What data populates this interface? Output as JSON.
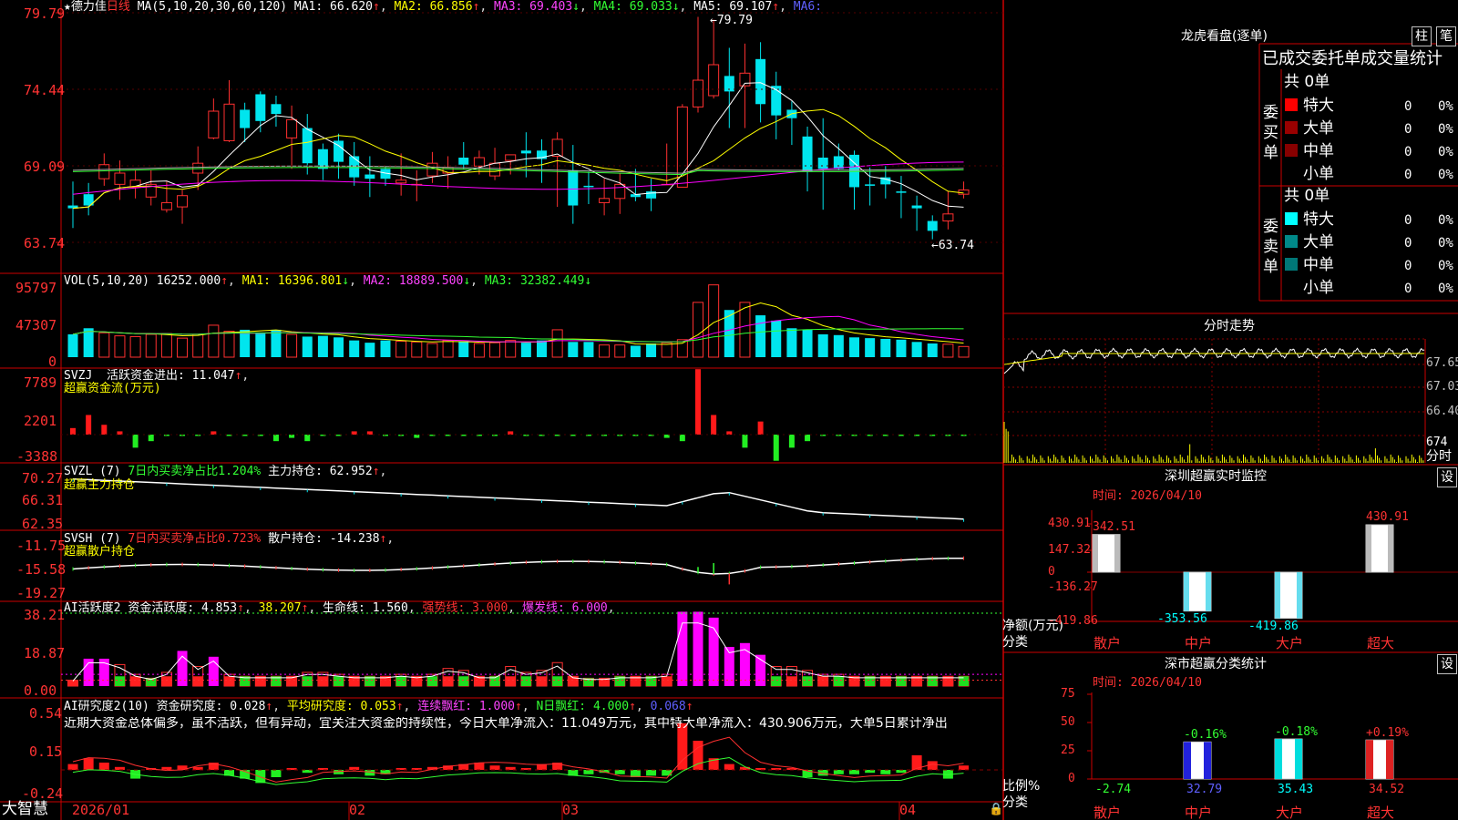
{
  "stock": {
    "name": "德力佳",
    "period": "日线"
  },
  "brand": "大智慧",
  "kline": {
    "ma_text": "MA(5,10,20,30,60,120)",
    "ma1": "MA1: 66.620",
    "ma2": "MA2: 66.856",
    "ma3": "MA3: 69.403",
    "ma4": "MA4: 69.033",
    "ma5": "MA5: 69.107",
    "ma6": "MA6:",
    "y_labels": [
      "79.79",
      "74.44",
      "69.09",
      "63.74"
    ],
    "high_label": "79.79",
    "low_label": "63.74"
  },
  "volume": {
    "title": "VOL(5,10,20)",
    "value": "16252.000",
    "ma1": "MA1: 16396.801",
    "ma2": "MA2: 18889.500",
    "ma3": "MA3: 32382.449",
    "y_labels": [
      "95797",
      "47307",
      "0"
    ]
  },
  "svzj": {
    "title": "SVZJ",
    "item": "活跃资金进出: 11.047",
    "subtitle": "超赢资金流(万元)",
    "y_labels": [
      "7789",
      "2201",
      "-3388"
    ]
  },
  "svzl": {
    "title": "SVZL (7)",
    "item1": "7日内买卖净占比1.204%",
    "item2": "主力持仓: 62.952",
    "subtitle": "超赢主力持仓",
    "y_labels": [
      "70.27",
      "66.31",
      "62.35"
    ]
  },
  "svsh": {
    "title": "SVSH (7)",
    "item1": "7日内买卖净占比0.723%",
    "item2": "散户持仓: -14.238",
    "subtitle": "超赢散户持仓",
    "y_labels": [
      "-11.75",
      "-15.58",
      "-19.27"
    ]
  },
  "ai_active": {
    "title": "AI活跃度2",
    "item1": "资金活跃度: 4.853",
    "item2": "38.207",
    "item3": "生命线: 1.560",
    "item4": "强势线: 3.000",
    "item5": "爆发线: 6.000",
    "y_labels": [
      "38.21",
      "18.87",
      "0.00"
    ]
  },
  "ai_research": {
    "title": "AI研究度2(10)",
    "item1": "资金研究度: 0.028",
    "item2": "平均研究度: 0.053",
    "item3": "连续飘红: 1.000",
    "item4": "N日飘红: 4.000",
    "item5": "0.068",
    "commentary": "近期大资金总体偏多，虽不活跃，但有异动，宜关注大资金的持续性，今日大单净流入：11.049万元，其中特大单净流入：430.906万元，大单5日累计净出",
    "y_labels": [
      "0.54",
      "0.15",
      "-0.24"
    ]
  },
  "x_axis": [
    "2026/01",
    "02",
    "03",
    "04"
  ],
  "longhu": {
    "title": "龙虎看盘(逐单)",
    "btn1": "柱",
    "btn2": "笔",
    "subtitle": "已成交委托单成交量统计",
    "buy_label": "委买单",
    "sell_label": "委卖单",
    "buy_total": "共 0单",
    "sell_total": "共 0单",
    "buy_rows": [
      {
        "name": "特大",
        "count": "0",
        "pct": "0%"
      },
      {
        "name": "大单",
        "count": "0",
        "pct": "0%"
      },
      {
        "name": "中单",
        "count": "0",
        "pct": "0%"
      },
      {
        "name": "小单",
        "count": "0",
        "pct": "0%"
      }
    ],
    "sell_rows": [
      {
        "name": "特大",
        "count": "0",
        "pct": "0%"
      },
      {
        "name": "大单",
        "count": "0",
        "pct": "0%"
      },
      {
        "name": "中单",
        "count": "0",
        "pct": "0%"
      },
      {
        "name": "小单",
        "count": "0",
        "pct": "0%"
      }
    ]
  },
  "intraday": {
    "title": "分时走势",
    "y_labels": [
      "67.65",
      "67.03",
      "66.40"
    ],
    "vol_label": "674",
    "time_label": "分时"
  },
  "realtime": {
    "title": "深圳超赢实时监控",
    "btn": "设",
    "time": "时间: 2026/04/10",
    "ylabel": "净额(万元)",
    "xlabel": "分类"
  },
  "classify": {
    "title": "深市超赢分类统计",
    "btn": "设",
    "time": "时间: 2026/04/10",
    "ylabel": "比例%",
    "xlabel": "分类"
  },
  "chart_data": [
    {
      "type": "bar",
      "title": "深圳超赢实时监控",
      "xlabel": "分类",
      "ylabel": "净额(万元)",
      "categories": [
        "散户",
        "中户",
        "大户",
        "超大"
      ],
      "values": [
        342.51,
        -353.56,
        -419.86,
        430.91
      ],
      "y_ticks": [
        "430.91",
        "147.32",
        "0",
        "-136.27",
        "-419.86"
      ],
      "ylim": [
        -419.86,
        430.91
      ]
    },
    {
      "type": "bar",
      "title": "深市超赢分类统计",
      "xlabel": "分类",
      "ylabel": "比例%",
      "categories": [
        "散户",
        "中户",
        "大户",
        "超大"
      ],
      "values": [
        -2.74,
        32.79,
        35.43,
        34.52
      ],
      "changes": [
        "",
        "-0.16%",
        "-0.18%",
        "+0.19%"
      ],
      "y_ticks": [
        "75",
        "50",
        "25",
        "0"
      ],
      "ylim": [
        0,
        75
      ]
    }
  ]
}
